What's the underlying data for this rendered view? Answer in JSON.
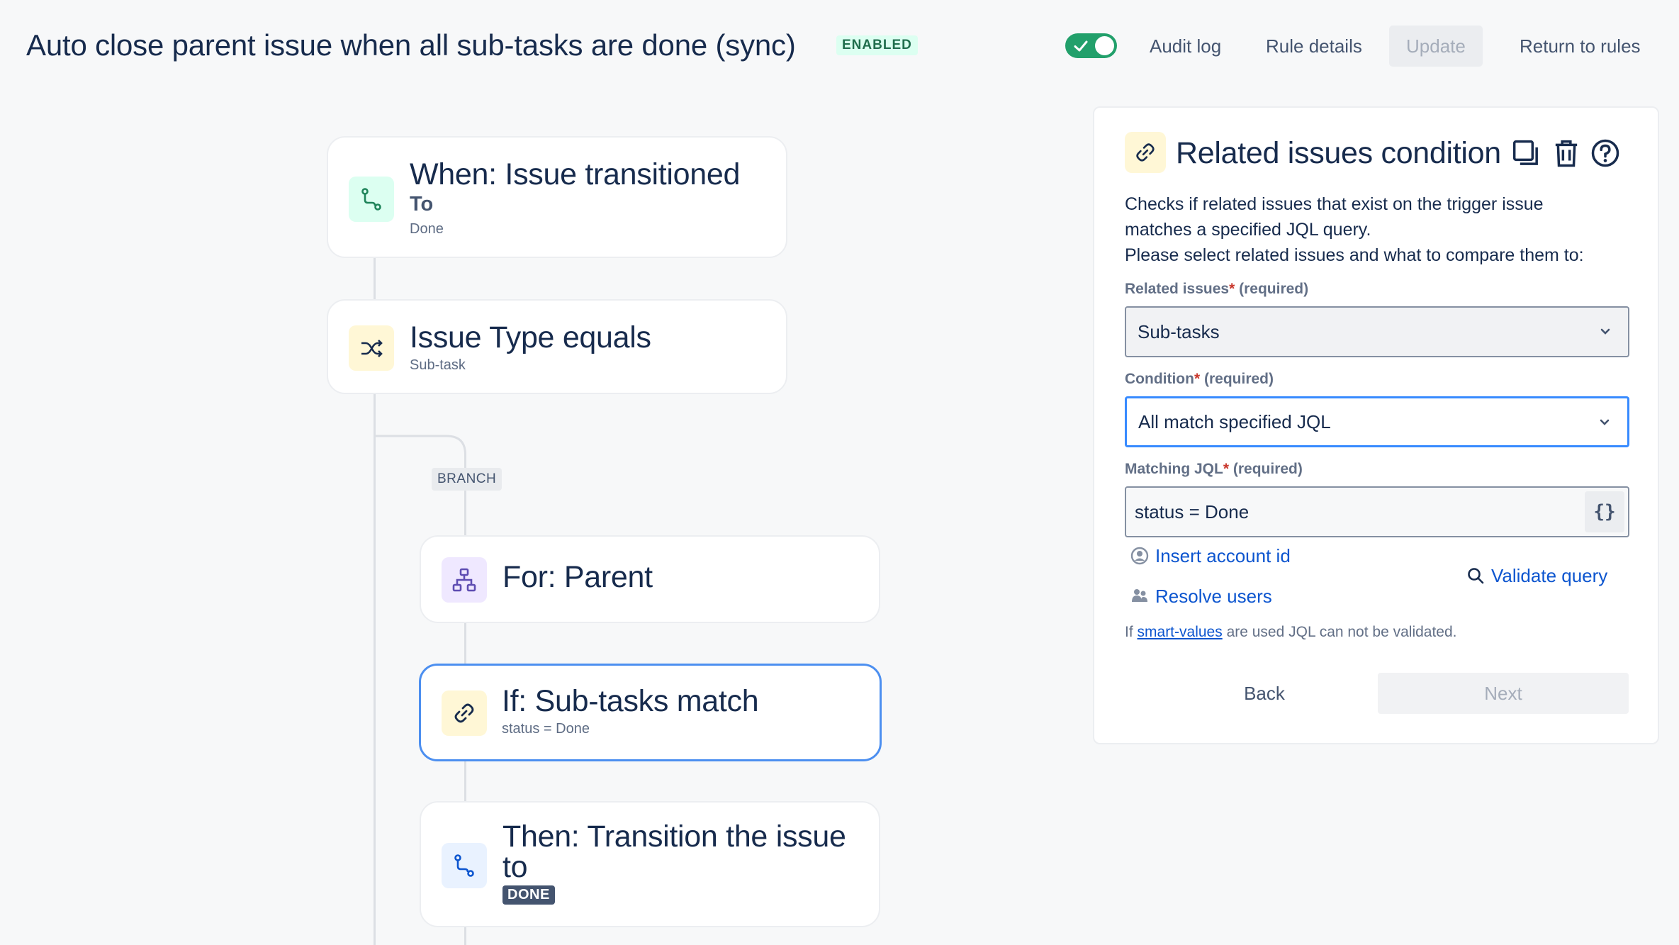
{
  "header": {
    "title": "Auto close parent issue when all sub-tasks are done (sync)",
    "status_badge": "ENABLED",
    "toggle_on": true,
    "audit_log": "Audit log",
    "rule_details": "Rule details",
    "update": "Update",
    "return_to_rules": "Return to rules"
  },
  "flow": {
    "trigger": {
      "title": "When: Issue transitioned",
      "subtitle": "To",
      "detail": "Done",
      "icon": "transition-icon"
    },
    "condition": {
      "title": "Issue Type equals",
      "detail": "Sub-task",
      "icon": "shuffle-icon"
    },
    "branch_tag": "BRANCH",
    "branch": {
      "title": "For: Parent",
      "icon": "hierarchy-icon"
    },
    "if_condition": {
      "title": "If: Sub-tasks match",
      "detail": "status = Done",
      "icon": "link-icon"
    },
    "action": {
      "title_line1": "Then: Transition the issue",
      "title_line2": "to",
      "lozenge": "DONE",
      "icon": "transition-icon"
    }
  },
  "panel": {
    "title": "Related issues condition",
    "icons": [
      "link-icon",
      "duplicate-icon",
      "trash-icon",
      "help-icon"
    ],
    "description_line1": "Checks if related issues that exist on the trigger issue",
    "description_line2": "matches a specified JQL query.",
    "description_line3": "Please select related issues and what to compare them to:",
    "related_issues": {
      "label": "Related issues",
      "required_mark": "*",
      "required_text": "(required)",
      "value": "Sub-tasks"
    },
    "condition": {
      "label": "Condition",
      "required_mark": "*",
      "required_text": "(required)",
      "value": "All match specified JQL"
    },
    "matching_jql": {
      "label": "Matching JQL",
      "required_mark": "*",
      "required_text": "(required)",
      "value": "status = Done",
      "smart_button": "{}"
    },
    "insert_account_id": "Insert account id",
    "resolve_users": "Resolve users",
    "validate_query": "Validate query",
    "note_prefix": "If",
    "note_link": "smart-values",
    "note_suffix": "are used JQL can not be validated.",
    "back": "Back",
    "next": "Next"
  },
  "colors": {
    "accent": "#388bff",
    "success": "#22a06b",
    "link": "#0c55cf",
    "required": "#c9372c"
  }
}
